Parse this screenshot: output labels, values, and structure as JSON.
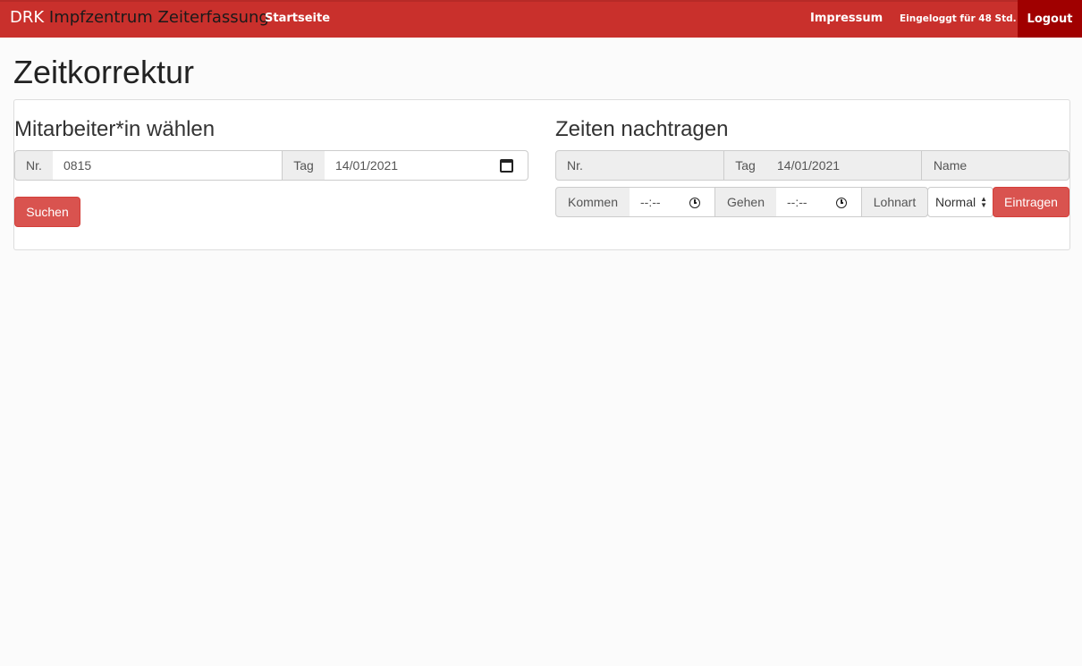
{
  "navbar": {
    "brand_prefix": "DRK",
    "brand_rest": " Impfzentrum Zeiterfassung",
    "home": "Startseite",
    "impressum": "Impressum",
    "logged_in": "Eingeloggt für 48 Std.",
    "logout": "Logout"
  },
  "page": {
    "title": "Zeitkorrektur"
  },
  "select_employee": {
    "title": "Mitarbeiter*in wählen",
    "nr_label": "Nr.",
    "nr_value": "0815",
    "day_label": "Tag",
    "day_value": "14/01/2021",
    "search_button": "Suchen"
  },
  "add_times": {
    "title": "Zeiten nachtragen",
    "nr_label": "Nr.",
    "nr_value": "",
    "day_label": "Tag",
    "day_value": "14/01/2021",
    "name_label": "Name",
    "name_value": "",
    "arrive_label": "Kommen",
    "arrive_value": "--:--",
    "leave_label": "Gehen",
    "leave_value": "--:--",
    "wage_label": "Lohnart",
    "wage_selected": "Normal",
    "submit_button": "Eintragen"
  },
  "colors": {
    "navbar": "#c9302c",
    "logout_bg": "#a00000",
    "danger_button": "#d9534f"
  },
  "icons": [
    "calendar-icon",
    "clock-icon",
    "select-arrows-icon"
  ]
}
